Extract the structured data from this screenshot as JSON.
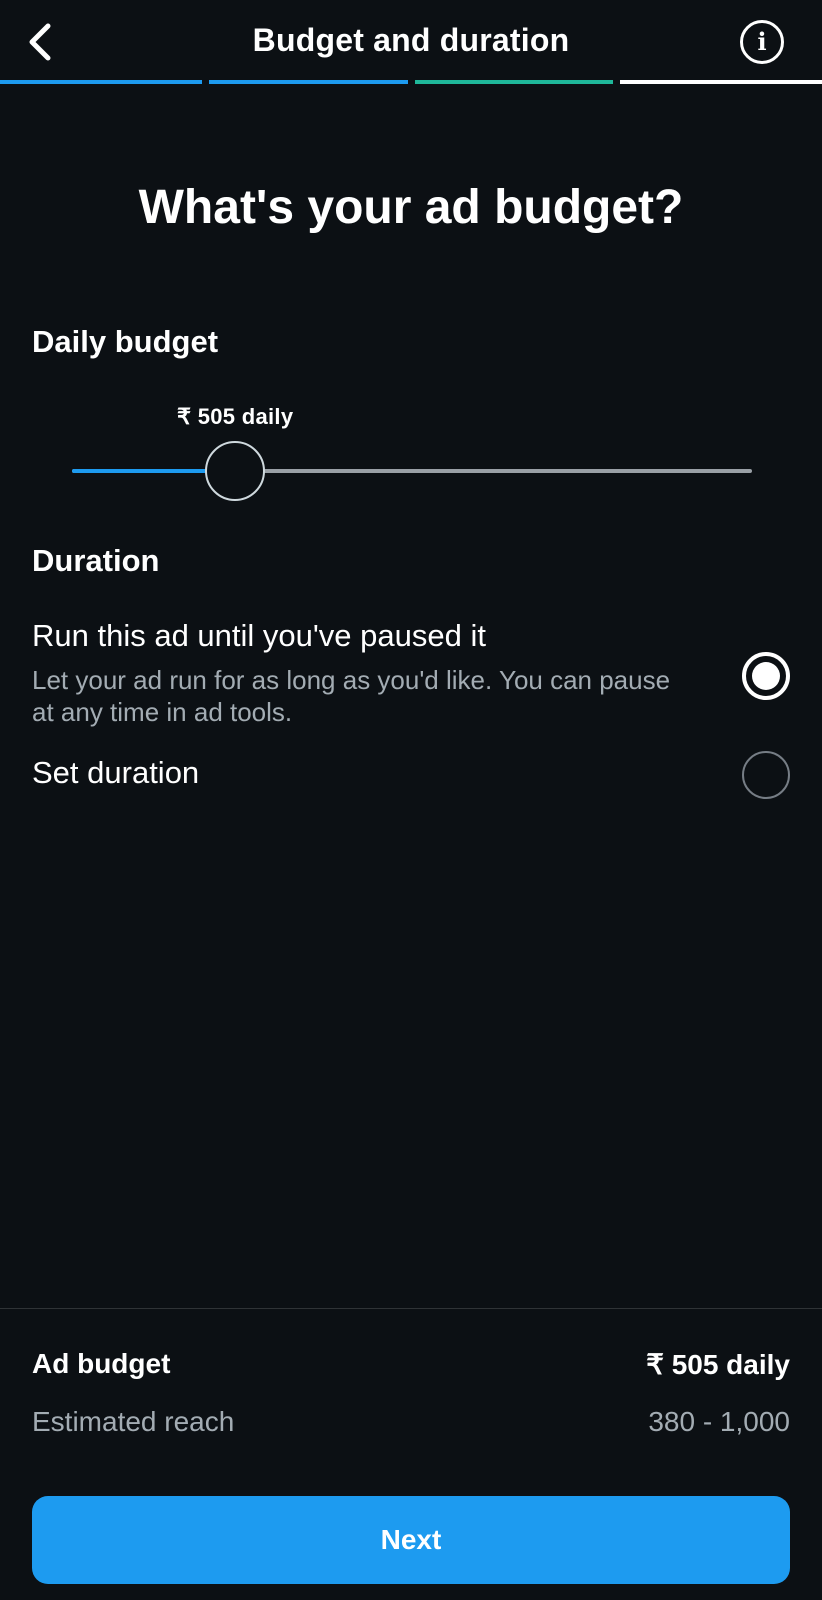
{
  "header": {
    "title": "Budget and duration",
    "back_icon": "chevron-left-icon",
    "info_icon": "info-icon",
    "info_glyph": "i"
  },
  "progress": {
    "steps_total": 4,
    "step_colors": [
      "#1d9bf0",
      "#1d9bf0",
      "#1fb89a",
      "#ffffff"
    ]
  },
  "question": "What's your ad budget?",
  "daily_budget": {
    "label": "Daily budget",
    "value_label": "₹ 505 daily",
    "slider_fraction": 0.24
  },
  "duration": {
    "label": "Duration",
    "options": [
      {
        "title": "Run this ad until you've paused it",
        "description": "Let your ad run for as long as you'd like. You can pause at any time in ad tools.",
        "selected": true
      },
      {
        "title": "Set duration",
        "description": "",
        "selected": false
      }
    ]
  },
  "summary": {
    "ad_budget_label": "Ad budget",
    "ad_budget_value": "₹ 505 daily",
    "reach_label": "Estimated reach",
    "reach_value": "380 - 1,000"
  },
  "next_button": "Next",
  "colors": {
    "background": "#0c1014",
    "accent": "#1d9bf0",
    "secondary_text": "#a3acb3"
  }
}
